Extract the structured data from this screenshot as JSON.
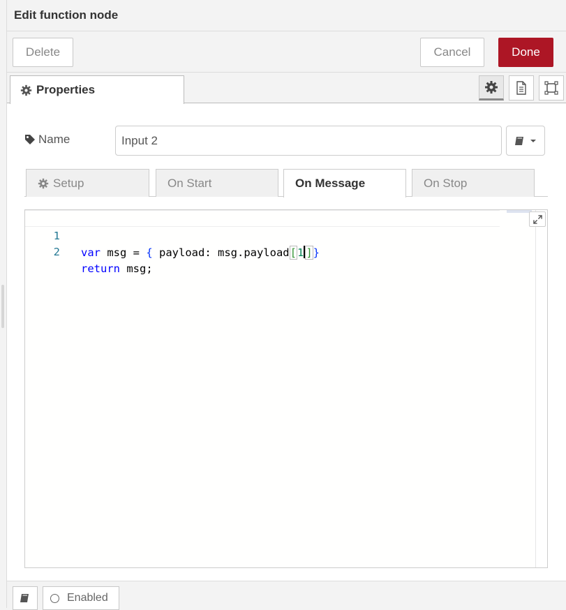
{
  "tray": {
    "title": "Edit function node"
  },
  "toolbar": {
    "delete_label": "Delete",
    "cancel_label": "Cancel",
    "done_label": "Done",
    "done_color": "#ad1625"
  },
  "tabs": {
    "properties_label": "Properties",
    "icons": [
      "gear-icon",
      "description-icon",
      "appearance-icon"
    ]
  },
  "form": {
    "name_label": "Name",
    "name_value": "Input 2"
  },
  "subtabs": [
    {
      "label": "Setup",
      "active": false
    },
    {
      "label": "On Start",
      "active": false
    },
    {
      "label": "On Message",
      "active": true
    },
    {
      "label": "On Stop",
      "active": false
    }
  ],
  "editor": {
    "lines": [
      {
        "number": "1",
        "text": "var msg = { payload: msg.payload[1]}"
      },
      {
        "number": "2",
        "text": "return msg;"
      }
    ],
    "tokens_line1": {
      "kw": "var",
      "p1": " msg = ",
      "ob": "{",
      "p2": " payload: msg.payload",
      "lb": "[",
      "num": "1",
      "rb": "]",
      "cb": "}"
    },
    "tokens_line2": {
      "kw": "return",
      "p1": " msg;"
    }
  },
  "footer": {
    "enabled_label": "Enabled"
  }
}
